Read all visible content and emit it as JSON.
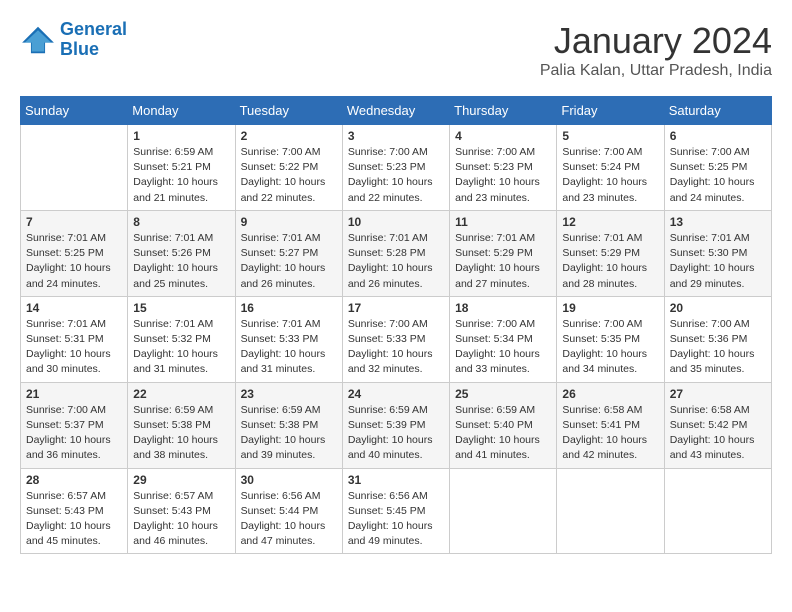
{
  "header": {
    "logo_line1": "General",
    "logo_line2": "Blue",
    "month": "January 2024",
    "location": "Palia Kalan, Uttar Pradesh, India"
  },
  "weekdays": [
    "Sunday",
    "Monday",
    "Tuesday",
    "Wednesday",
    "Thursday",
    "Friday",
    "Saturday"
  ],
  "weeks": [
    [
      {
        "day": "",
        "info": ""
      },
      {
        "day": "1",
        "info": "Sunrise: 6:59 AM\nSunset: 5:21 PM\nDaylight: 10 hours\nand 21 minutes."
      },
      {
        "day": "2",
        "info": "Sunrise: 7:00 AM\nSunset: 5:22 PM\nDaylight: 10 hours\nand 22 minutes."
      },
      {
        "day": "3",
        "info": "Sunrise: 7:00 AM\nSunset: 5:23 PM\nDaylight: 10 hours\nand 22 minutes."
      },
      {
        "day": "4",
        "info": "Sunrise: 7:00 AM\nSunset: 5:23 PM\nDaylight: 10 hours\nand 23 minutes."
      },
      {
        "day": "5",
        "info": "Sunrise: 7:00 AM\nSunset: 5:24 PM\nDaylight: 10 hours\nand 23 minutes."
      },
      {
        "day": "6",
        "info": "Sunrise: 7:00 AM\nSunset: 5:25 PM\nDaylight: 10 hours\nand 24 minutes."
      }
    ],
    [
      {
        "day": "7",
        "info": "Sunrise: 7:01 AM\nSunset: 5:25 PM\nDaylight: 10 hours\nand 24 minutes."
      },
      {
        "day": "8",
        "info": "Sunrise: 7:01 AM\nSunset: 5:26 PM\nDaylight: 10 hours\nand 25 minutes."
      },
      {
        "day": "9",
        "info": "Sunrise: 7:01 AM\nSunset: 5:27 PM\nDaylight: 10 hours\nand 26 minutes."
      },
      {
        "day": "10",
        "info": "Sunrise: 7:01 AM\nSunset: 5:28 PM\nDaylight: 10 hours\nand 26 minutes."
      },
      {
        "day": "11",
        "info": "Sunrise: 7:01 AM\nSunset: 5:29 PM\nDaylight: 10 hours\nand 27 minutes."
      },
      {
        "day": "12",
        "info": "Sunrise: 7:01 AM\nSunset: 5:29 PM\nDaylight: 10 hours\nand 28 minutes."
      },
      {
        "day": "13",
        "info": "Sunrise: 7:01 AM\nSunset: 5:30 PM\nDaylight: 10 hours\nand 29 minutes."
      }
    ],
    [
      {
        "day": "14",
        "info": "Sunrise: 7:01 AM\nSunset: 5:31 PM\nDaylight: 10 hours\nand 30 minutes."
      },
      {
        "day": "15",
        "info": "Sunrise: 7:01 AM\nSunset: 5:32 PM\nDaylight: 10 hours\nand 31 minutes."
      },
      {
        "day": "16",
        "info": "Sunrise: 7:01 AM\nSunset: 5:33 PM\nDaylight: 10 hours\nand 31 minutes."
      },
      {
        "day": "17",
        "info": "Sunrise: 7:00 AM\nSunset: 5:33 PM\nDaylight: 10 hours\nand 32 minutes."
      },
      {
        "day": "18",
        "info": "Sunrise: 7:00 AM\nSunset: 5:34 PM\nDaylight: 10 hours\nand 33 minutes."
      },
      {
        "day": "19",
        "info": "Sunrise: 7:00 AM\nSunset: 5:35 PM\nDaylight: 10 hours\nand 34 minutes."
      },
      {
        "day": "20",
        "info": "Sunrise: 7:00 AM\nSunset: 5:36 PM\nDaylight: 10 hours\nand 35 minutes."
      }
    ],
    [
      {
        "day": "21",
        "info": "Sunrise: 7:00 AM\nSunset: 5:37 PM\nDaylight: 10 hours\nand 36 minutes."
      },
      {
        "day": "22",
        "info": "Sunrise: 6:59 AM\nSunset: 5:38 PM\nDaylight: 10 hours\nand 38 minutes."
      },
      {
        "day": "23",
        "info": "Sunrise: 6:59 AM\nSunset: 5:38 PM\nDaylight: 10 hours\nand 39 minutes."
      },
      {
        "day": "24",
        "info": "Sunrise: 6:59 AM\nSunset: 5:39 PM\nDaylight: 10 hours\nand 40 minutes."
      },
      {
        "day": "25",
        "info": "Sunrise: 6:59 AM\nSunset: 5:40 PM\nDaylight: 10 hours\nand 41 minutes."
      },
      {
        "day": "26",
        "info": "Sunrise: 6:58 AM\nSunset: 5:41 PM\nDaylight: 10 hours\nand 42 minutes."
      },
      {
        "day": "27",
        "info": "Sunrise: 6:58 AM\nSunset: 5:42 PM\nDaylight: 10 hours\nand 43 minutes."
      }
    ],
    [
      {
        "day": "28",
        "info": "Sunrise: 6:57 AM\nSunset: 5:43 PM\nDaylight: 10 hours\nand 45 minutes."
      },
      {
        "day": "29",
        "info": "Sunrise: 6:57 AM\nSunset: 5:43 PM\nDaylight: 10 hours\nand 46 minutes."
      },
      {
        "day": "30",
        "info": "Sunrise: 6:56 AM\nSunset: 5:44 PM\nDaylight: 10 hours\nand 47 minutes."
      },
      {
        "day": "31",
        "info": "Sunrise: 6:56 AM\nSunset: 5:45 PM\nDaylight: 10 hours\nand 49 minutes."
      },
      {
        "day": "",
        "info": ""
      },
      {
        "day": "",
        "info": ""
      },
      {
        "day": "",
        "info": ""
      }
    ]
  ]
}
